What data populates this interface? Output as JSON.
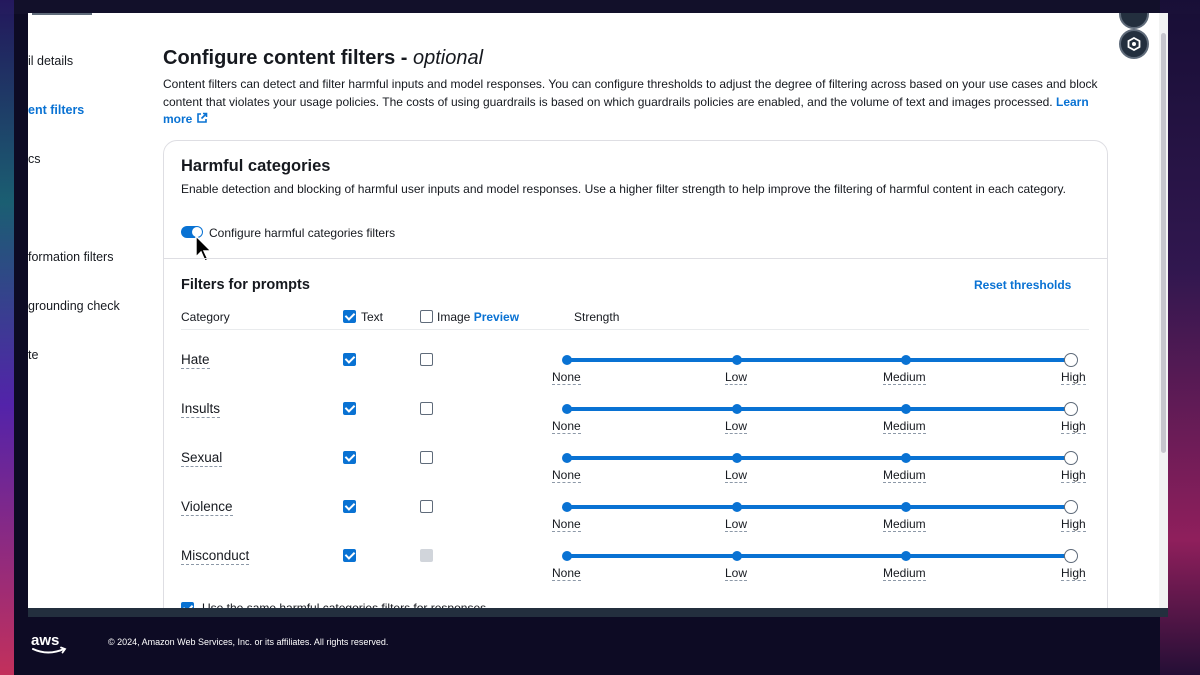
{
  "sidebar": {
    "items": [
      {
        "label": "il details",
        "active": false
      },
      {
        "label": "ent filters",
        "active": true
      },
      {
        "label": "cs",
        "active": false
      },
      {
        "label": "formation filters",
        "active": false
      },
      {
        "label": "grounding check",
        "active": false
      },
      {
        "label": "te",
        "active": false
      }
    ]
  },
  "header": {
    "title": "Configure content filters - ",
    "title_suffix": "optional",
    "description": "Content filters can detect and filter harmful inputs and model responses. You can configure thresholds to adjust the degree of filtering across based on your use cases and block content that violates your usage policies. The costs of using guardrails is based on which guardrails policies are enabled, and the volume of text and images processed.",
    "learn_more": "Learn more"
  },
  "harmful_categories": {
    "title": "Harmful categories",
    "description": "Enable detection and blocking of harmful user inputs and model responses. Use a higher filter strength to help improve the filtering of harmful content in each category.",
    "toggle_label": "Configure harmful categories filters",
    "toggle_on": true
  },
  "prompts_filters": {
    "title": "Filters for prompts",
    "reset_label": "Reset thresholds",
    "columns": {
      "category": "Category",
      "text": "Text",
      "image": "Image",
      "preview": "Preview",
      "strength": "Strength"
    },
    "text_header_checked": true,
    "image_header_checked": false,
    "strength_levels": [
      "None",
      "Low",
      "Medium",
      "High"
    ],
    "rows": [
      {
        "category": "Hate",
        "text": true,
        "image": "unchecked",
        "strength": "High"
      },
      {
        "category": "Insults",
        "text": true,
        "image": "unchecked",
        "strength": "High"
      },
      {
        "category": "Sexual",
        "text": true,
        "image": "unchecked",
        "strength": "High"
      },
      {
        "category": "Violence",
        "text": true,
        "image": "unchecked",
        "strength": "High"
      },
      {
        "category": "Misconduct",
        "text": true,
        "image": "disabled",
        "strength": "High"
      }
    ],
    "same_for_responses_label": "Use the same harmful categories filters for responses",
    "same_for_responses_checked": true
  },
  "footer": {
    "logo_text": "aws",
    "copyright": "© 2024, Amazon Web Services, Inc. or its affiliates. All rights reserved."
  },
  "colors": {
    "accent": "#0972d3",
    "text": "#16191f",
    "border": "#dedee3"
  }
}
